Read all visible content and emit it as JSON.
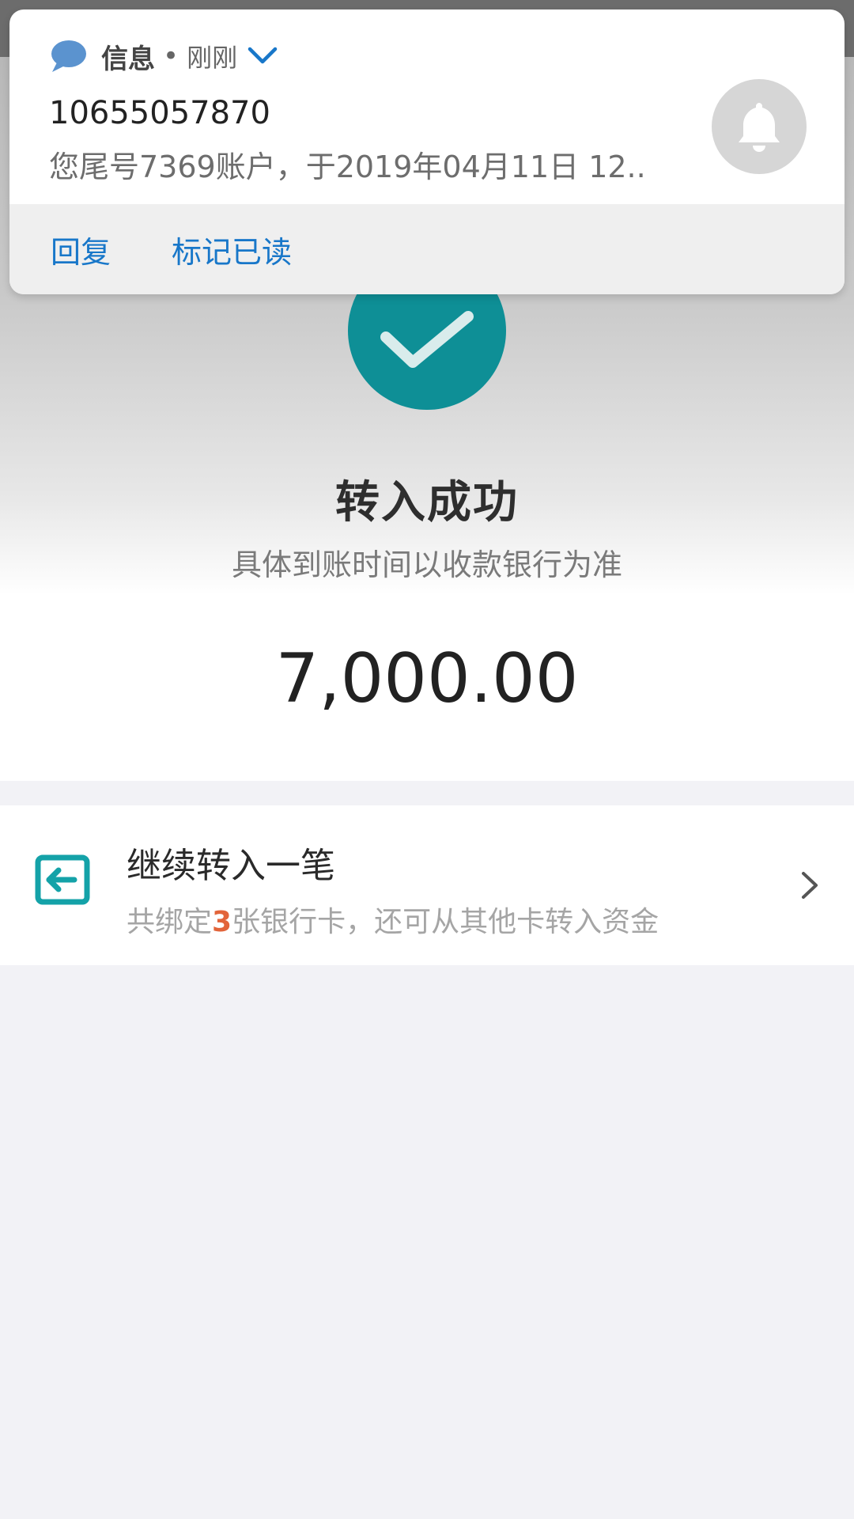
{
  "notification": {
    "app_name": "信息",
    "separator": "•",
    "time": "刚刚",
    "sender": "10655057870",
    "preview": "您尾号7369账户，于2019年04月11日 12..",
    "actions": {
      "reply": "回复",
      "mark_read": "标记已读"
    },
    "icons": {
      "app": "chat-bubble-icon",
      "expand": "chevron-down-icon",
      "bell": "bell-icon"
    }
  },
  "result": {
    "status_title": "转入成功",
    "status_subtitle": "具体到账时间以收款银行为准",
    "amount": "7,000.00",
    "icon": "checkmark-icon"
  },
  "continue": {
    "title": "继续转入一笔",
    "desc_prefix": "共绑定",
    "desc_count": "3",
    "desc_suffix": "张银行卡，还可从其他卡转入资金",
    "icon": "transfer-in-icon",
    "chevron": "chevron-right-icon"
  },
  "colors": {
    "accent_teal": "#0e8f96",
    "link_blue": "#1877c9",
    "highlight_orange": "#e2643a"
  }
}
